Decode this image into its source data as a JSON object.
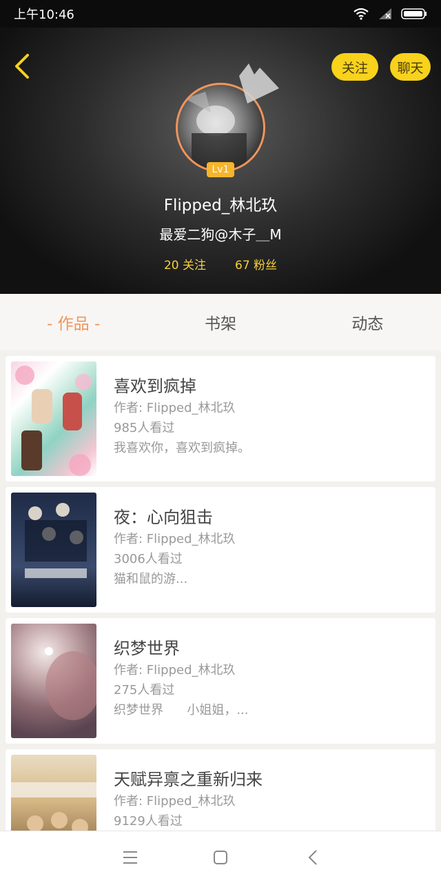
{
  "status_bar": {
    "time": "上午10:46"
  },
  "header": {
    "follow_label": "关注",
    "chat_label": "聊天",
    "level": "Lv1",
    "username": "Flipped_林北玖",
    "signature": "最爱二狗@木子＿M",
    "following": "20 关注",
    "fans": "67 粉丝",
    "accent_color": "#f8d21b"
  },
  "tabs": [
    {
      "label": "- 作品 -"
    },
    {
      "label": "书架"
    },
    {
      "label": "动态"
    }
  ],
  "books": [
    {
      "title": "喜欢到疯掉",
      "author": "作者: Flipped_林北玖",
      "views": "985人看过",
      "desc": "我喜欢你，喜欢到疯掉。"
    },
    {
      "title": "夜：心向狙击",
      "author": "作者: Flipped_林北玖",
      "views": "3006人看过",
      "desc": "猫和鼠的游..."
    },
    {
      "title": "织梦世界",
      "author": "作者: Flipped_林北玖",
      "views": "275人看过",
      "desc": "织梦世界      小姐姐，..."
    },
    {
      "title": "天赋异禀之重新归来",
      "author": "作者: Flipped_林北玖",
      "views": "9129人看过",
      "desc": ""
    }
  ],
  "icons": {
    "back": "back-arrow-icon",
    "wifi": "wifi-icon",
    "signal": "signal-icon",
    "battery": "battery-icon",
    "menu": "menu-icon",
    "home": "home-icon",
    "nav_back": "nav-back-icon"
  }
}
